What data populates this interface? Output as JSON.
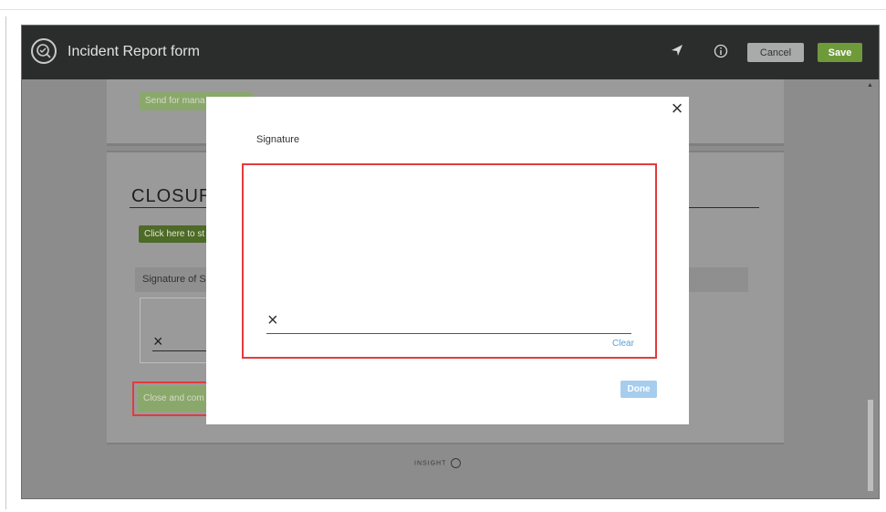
{
  "header": {
    "title": "Incident Report form",
    "cancel_label": "Cancel",
    "save_label": "Save",
    "location_icon": "location-arrow-icon",
    "info_icon": "info-icon"
  },
  "form": {
    "send_manager_label": "Send for mana",
    "closure_heading": "CLOSURE",
    "start_button_label": "Click here to st",
    "signature_label": "Signature of S",
    "close_complete_label": "Close and com"
  },
  "footer": {
    "brand": "INSIGHT"
  },
  "modal": {
    "title": "Signature",
    "clear_label": "Clear",
    "done_label": "Done",
    "close_symbol": "×",
    "sign_mark": "×"
  },
  "colors": {
    "topbar": "#2b2d2d",
    "save": "#6f9a3a",
    "highlight": "#e33b3b",
    "link": "#58a0d8"
  }
}
